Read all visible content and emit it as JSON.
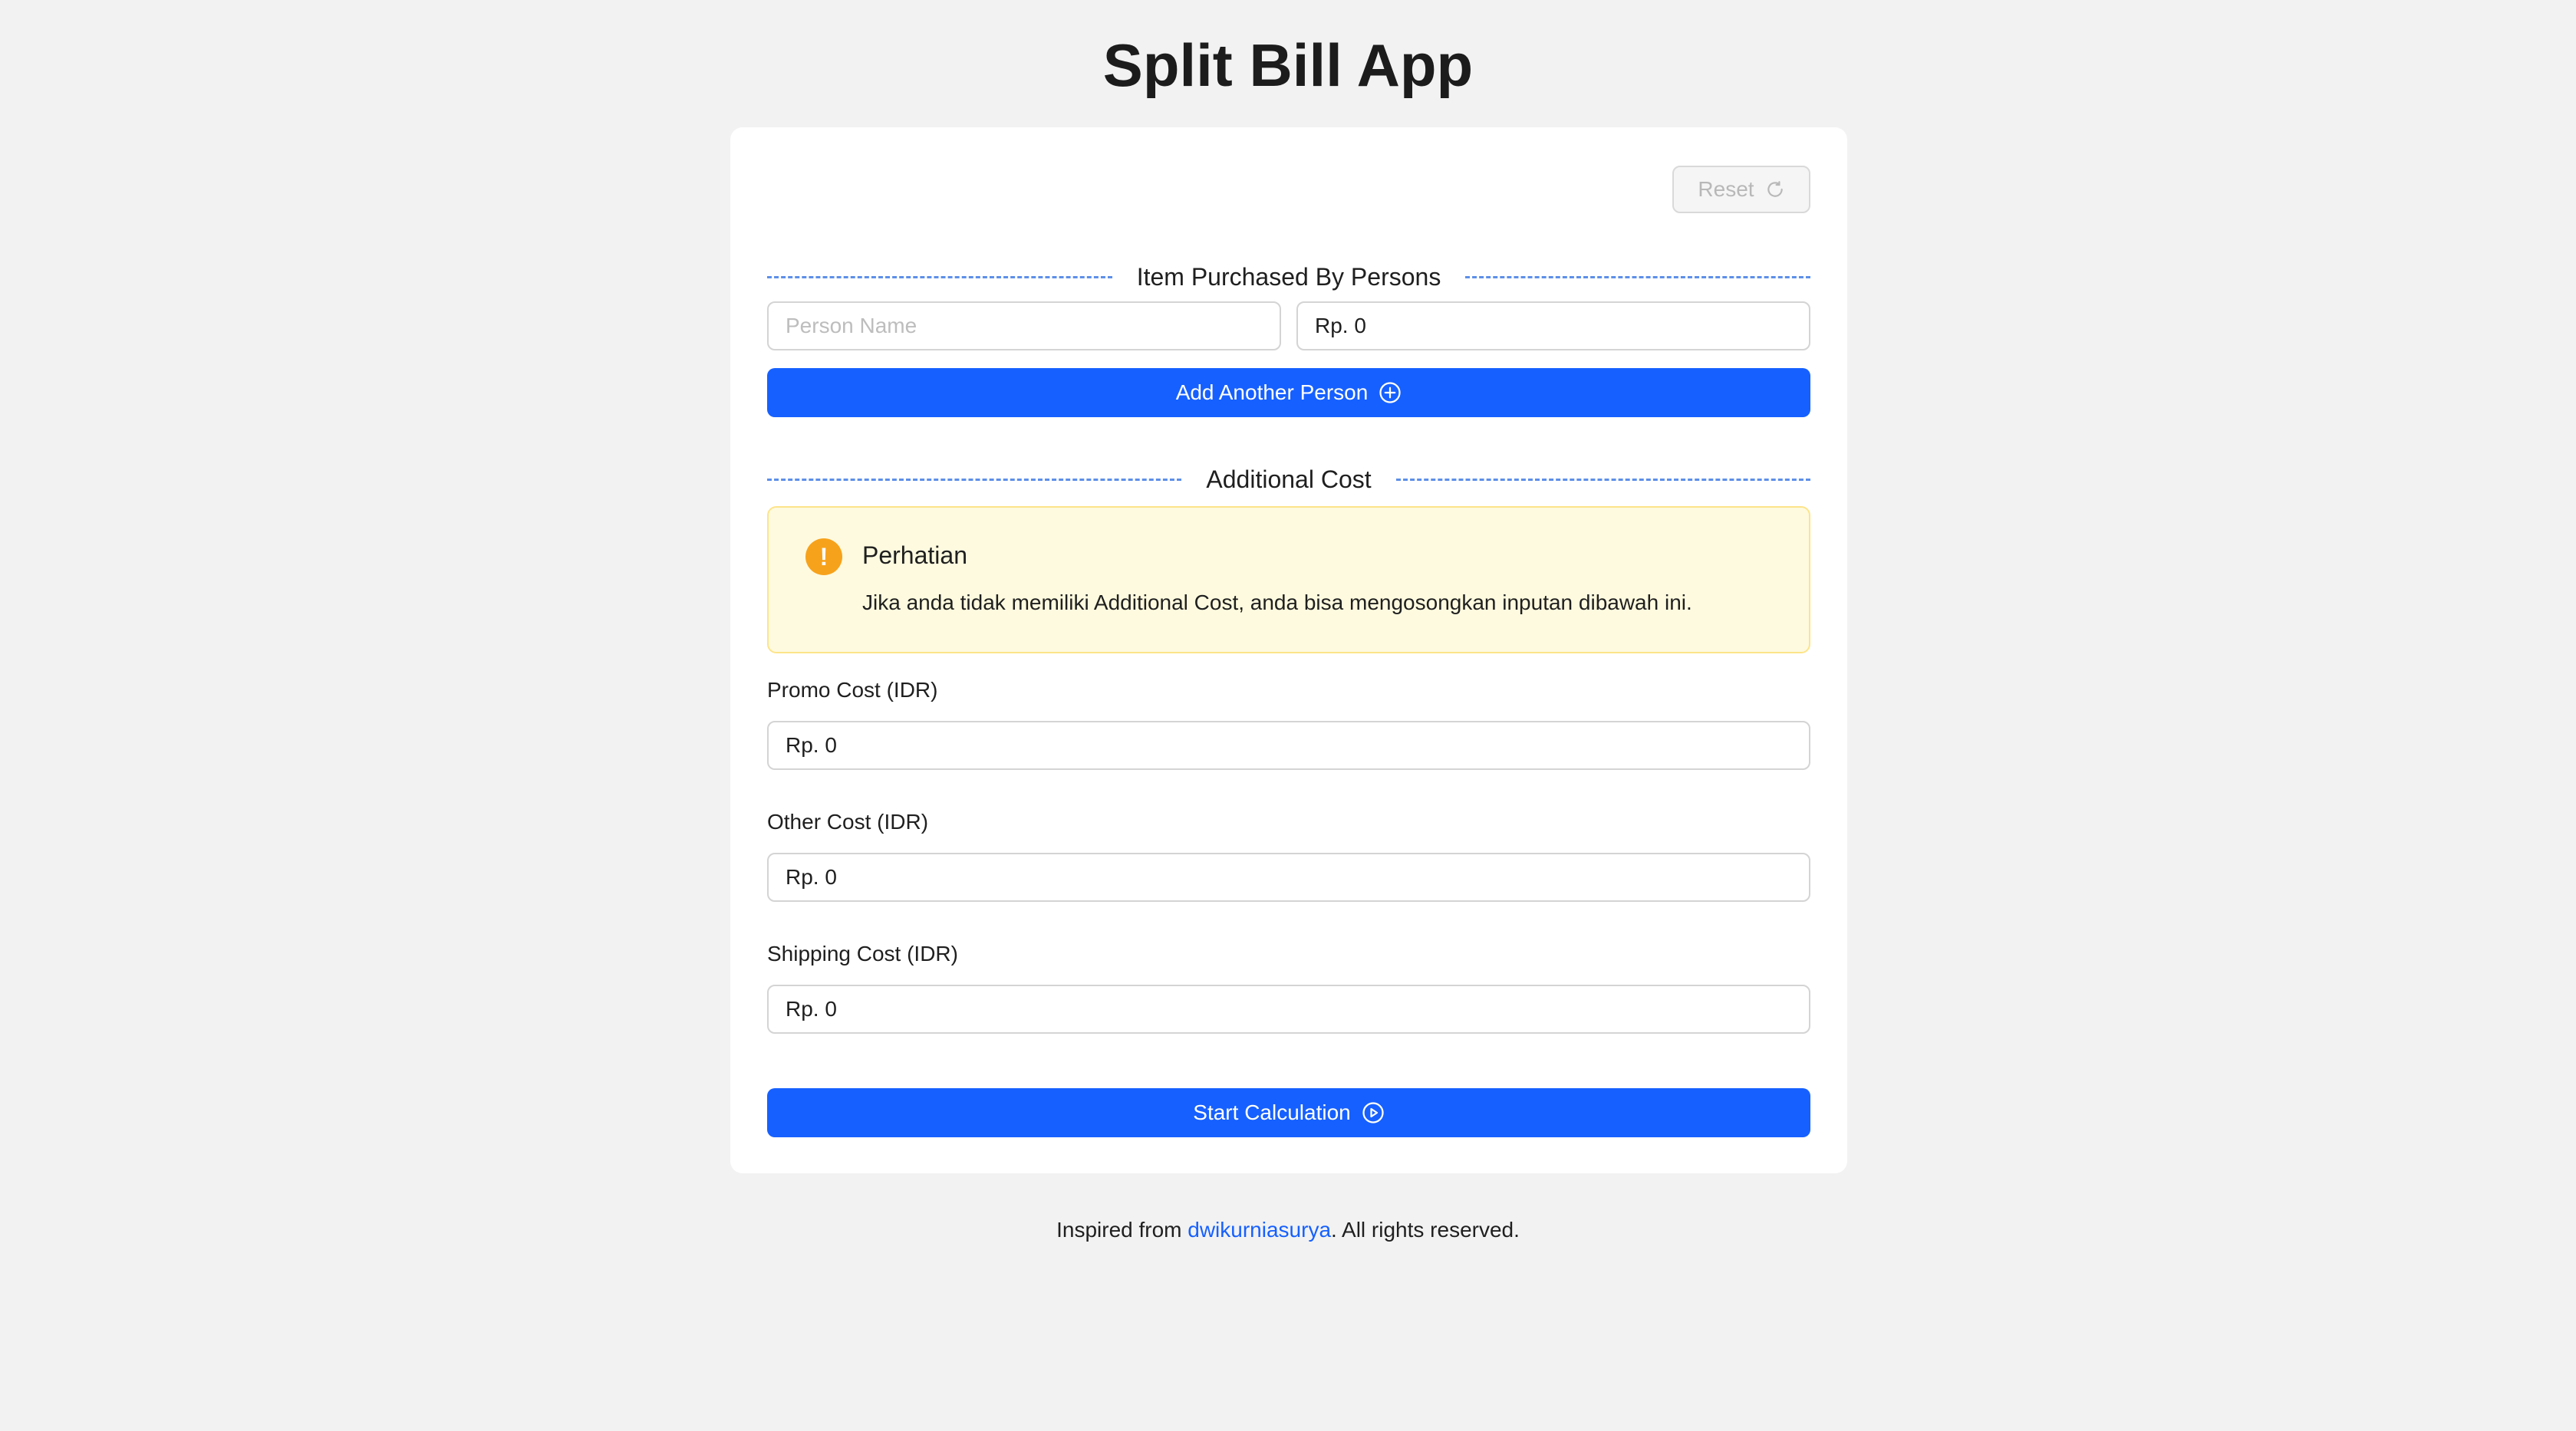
{
  "app": {
    "title": "Split Bill App"
  },
  "toolbar": {
    "reset_label": "Reset",
    "reset_icon": "refresh-icon"
  },
  "persons_section": {
    "title": "Item Purchased By Persons",
    "person_name_placeholder": "Person Name",
    "person_name_value": "",
    "amount_value": "Rp. 0",
    "add_person_label": "Add Another Person",
    "add_person_icon": "plus-circle-icon"
  },
  "additional_section": {
    "title": "Additional Cost",
    "alert": {
      "icon": "exclamation-icon",
      "title": "Perhatian",
      "message": "Jika anda tidak memiliki Additional Cost, anda bisa mengosongkan inputan dibawah ini."
    },
    "fields": [
      {
        "label": "Promo Cost (IDR)",
        "value": "Rp. 0"
      },
      {
        "label": "Other Cost (IDR)",
        "value": "Rp. 0"
      },
      {
        "label": "Shipping Cost (IDR)",
        "value": "Rp. 0"
      }
    ]
  },
  "actions": {
    "start_label": "Start Calculation",
    "start_icon": "play-circle-icon"
  },
  "footer": {
    "prefix": "Inspired from ",
    "link_text": "dwikurniasurya",
    "suffix": ". All rights reserved."
  },
  "colors": {
    "primary": "#1660ff",
    "divider": "#5d8fe8",
    "alert_bg": "#fefadf",
    "alert_border": "#fde48a",
    "alert_icon": "#f7a21b",
    "page_bg": "#f2f2f2"
  }
}
